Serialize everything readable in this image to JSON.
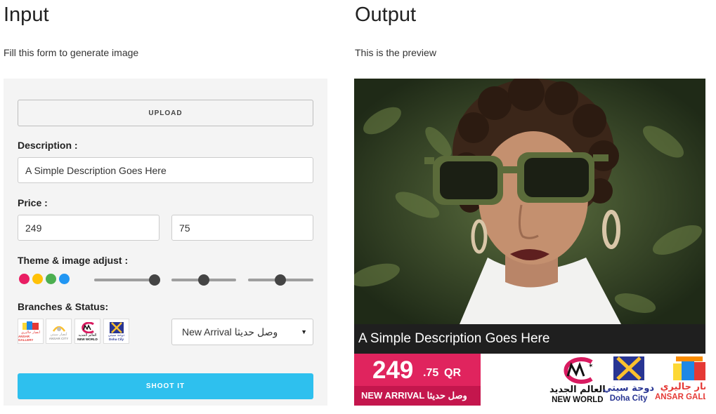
{
  "input": {
    "title": "Input",
    "subtitle": "Fill this form to generate image",
    "upload_label": "UPLOAD",
    "description_label": "Description :",
    "description_value": "A Simple Description Goes Here",
    "price_label": "Price :",
    "price_whole": "249",
    "price_fraction": "75",
    "theme_label": "Theme & image adjust :",
    "theme_colors": [
      "#e91e63",
      "#ffc107",
      "#4caf50",
      "#2196f3"
    ],
    "adjust_levels": [
      0.9,
      0.5,
      0.5
    ],
    "branches_label": "Branches & Status:",
    "status_selected": "New Arrival وصل حديثا",
    "shoot_label": "SHOOT IT"
  },
  "output": {
    "title": "Output",
    "subtitle": "This is the preview",
    "description": "A Simple Description Goes Here",
    "price_whole": "249",
    "price_fraction": ".75",
    "currency": "QR",
    "status_text": "NEW ARRIVAL وصل حديثا"
  },
  "branches": [
    {
      "name_ar": "انصار جاليري",
      "name_en": "ANSAR GALLERY",
      "color": "#e53935",
      "icon": "ansar-gallery-logo"
    },
    {
      "name_ar": "أنصار سيتي",
      "name_en": "ANSAR CITY",
      "color": "#9e9e9e",
      "icon": "ansar-city-logo"
    },
    {
      "name_ar": "العالم الجديد",
      "name_en": "NEW WORLD",
      "color": "#111111",
      "icon": "new-world-logo"
    },
    {
      "name_ar": "دوحة سيتي",
      "name_en": "Doha City",
      "color": "#283593",
      "icon": "doha-city-logo"
    }
  ]
}
